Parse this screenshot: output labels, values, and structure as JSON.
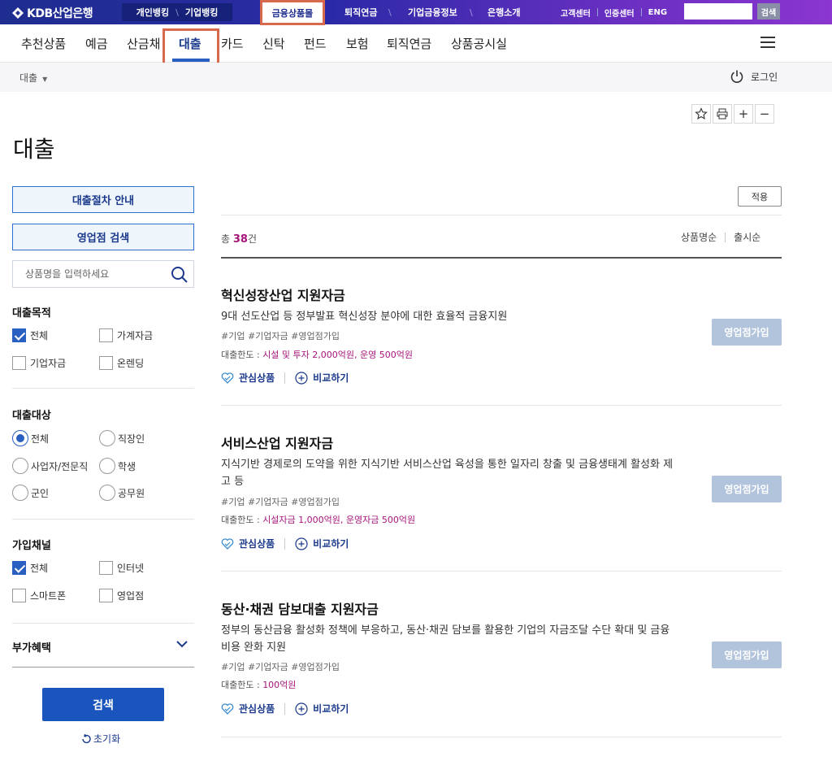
{
  "top": {
    "logo_text": "KDB산업은행",
    "personal_banking": "개인뱅킹",
    "corporate_banking": "기업뱅킹",
    "menu": [
      "금융상품몰",
      "퇴직연금",
      "기업금융정보",
      "은행소개"
    ],
    "util": [
      "고객센터",
      "인증센터",
      "ENG"
    ],
    "search_value": "",
    "search_button": "검색"
  },
  "nav": {
    "items": [
      "추천상품",
      "예금",
      "산금채",
      "대출",
      "카드",
      "신탁",
      "펀드",
      "보험",
      "퇴직연금",
      "상품공시실"
    ],
    "active": "대출"
  },
  "breadcrumb": {
    "current": "대출"
  },
  "login_label": "로그인",
  "page_title": "대출",
  "left": {
    "guide_button": "대출절차 안내",
    "branch_button": "영업점 검색",
    "search_placeholder": "상품명을 입력하세요",
    "purpose": {
      "title": "대출목적",
      "options": [
        "전체",
        "가계자금",
        "기업자금",
        "온렌딩"
      ]
    },
    "target": {
      "title": "대출대상",
      "options": [
        "전체",
        "직장인",
        "사업자/전문직",
        "학생",
        "군인",
        "공무원"
      ]
    },
    "channel": {
      "title": "가입채널",
      "options": [
        "전체",
        "인터넷",
        "스마트폰",
        "영업점"
      ]
    },
    "benefit": {
      "title": "부가혜택"
    },
    "search_button": "검색",
    "reset_label": "초기화"
  },
  "list": {
    "apply_button": "적용",
    "total_prefix": "총",
    "total_count": "38",
    "total_suffix": "건",
    "sort": [
      "상품명순",
      "출시순"
    ],
    "products": [
      {
        "title": "혁신성장산업 지원자금",
        "desc": "9대 선도산업 등 정부발표 혁신성장 분야에 대한 효율적 금융지원",
        "tags": "#기업 #기업자금 #영업점가입",
        "limit_label": "대출한도 :",
        "limit_value": "시설 및 투자 2,000억원, 운영 500억원",
        "fav": "관심상품",
        "compare": "비교하기",
        "join": "영업점가입"
      },
      {
        "title": "서비스산업 지원자금",
        "desc": "지식기반 경제로의 도약을 위한 지식기반 서비스산업 육성을 통한 일자리 창출 및 금융생태계 활성화 제고 등",
        "tags": "#기업 #기업자금 #영업점가입",
        "limit_label": "대출한도 :",
        "limit_value": "시설자금 1,000억원, 운영자금 500억원",
        "fav": "관심상품",
        "compare": "비교하기",
        "join": "영업점가입"
      },
      {
        "title": "동산·채권 담보대출 지원자금",
        "desc": "정부의 동산금융 활성화 정책에 부응하고, 동산·채권 담보를 활용한 기업의 자금조달 수단 확대 및 금융비용 완화 지원",
        "tags": "#기업 #기업자금 #영업점가입",
        "limit_label": "대출한도 :",
        "limit_value": "100억원",
        "fav": "관심상품",
        "compare": "비교하기",
        "join": "영업점가입"
      }
    ]
  }
}
